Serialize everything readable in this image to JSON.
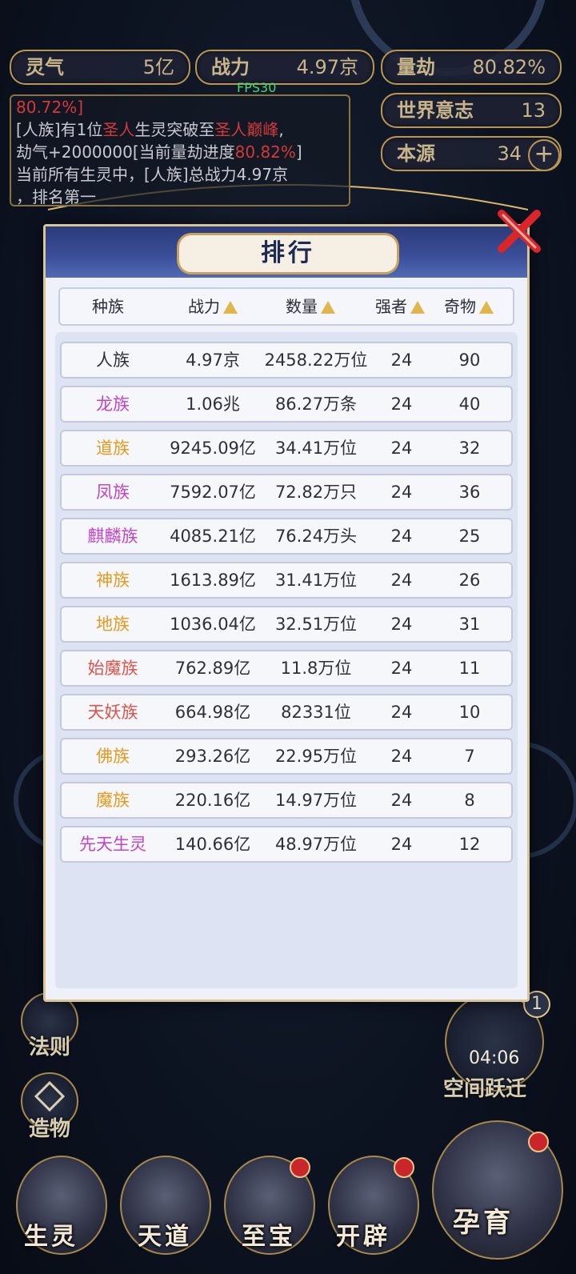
{
  "hud": {
    "lingqi_label": "灵气",
    "lingqi_value": "5亿",
    "power_label": "战力",
    "power_value": "4.97京",
    "jie_label": "量劫",
    "jie_value": "80.82%",
    "world_label": "世界意志",
    "world_value": "13",
    "source_label": "本源",
    "source_value": "34",
    "plus": "+",
    "fps": "FPS30"
  },
  "log": {
    "line1": "80.72%]",
    "line2_a": "[人族]有1位",
    "line2_b": "圣人",
    "line2_c": "生灵突破至",
    "line2_d": "圣人巅峰",
    "line2_e": ",",
    "line3_a": "劫气+2000000[当前量劫进度",
    "line3_b": "80.82%",
    "line3_c": "]",
    "line4": "当前所有生灵中，[人族]总战力4.97京",
    "line5": "，排名第一"
  },
  "side": {
    "fate_label": "法则",
    "create_label": "造物",
    "space_label": "空间跃迁",
    "timer": "04:06",
    "badge": "1"
  },
  "bottom": {
    "btn1": "生灵",
    "btn2": "天道",
    "btn3": "至宝",
    "btn4": "开辟",
    "btn5": "孕育"
  },
  "modal": {
    "title": "排行",
    "headers": {
      "race": "种族",
      "power": "战力",
      "count": "数量",
      "strong": "强者",
      "odd": "奇物"
    },
    "rows": [
      {
        "race": "人族",
        "color": "#2f2f3a",
        "power": "4.97京",
        "count": "2458.22万位",
        "strong": "24",
        "odd": "90"
      },
      {
        "race": "龙族",
        "color": "#c144c9",
        "power": "1.06兆",
        "count": "86.27万条",
        "strong": "24",
        "odd": "40"
      },
      {
        "race": "道族",
        "color": "#e59a1e",
        "power": "9245.09亿",
        "count": "34.41万位",
        "strong": "24",
        "odd": "32"
      },
      {
        "race": "凤族",
        "color": "#c144c9",
        "power": "7592.07亿",
        "count": "72.82万只",
        "strong": "24",
        "odd": "36"
      },
      {
        "race": "麒麟族",
        "color": "#c144c9",
        "power": "4085.21亿",
        "count": "76.24万头",
        "strong": "24",
        "odd": "25"
      },
      {
        "race": "神族",
        "color": "#e59a1e",
        "power": "1613.89亿",
        "count": "31.41万位",
        "strong": "24",
        "odd": "26"
      },
      {
        "race": "地族",
        "color": "#e59a1e",
        "power": "1036.04亿",
        "count": "32.51万位",
        "strong": "24",
        "odd": "31"
      },
      {
        "race": "始魔族",
        "color": "#e0524a",
        "power": "762.89亿",
        "count": "11.8万位",
        "strong": "24",
        "odd": "11"
      },
      {
        "race": "天妖族",
        "color": "#e0524a",
        "power": "664.98亿",
        "count": "82331位",
        "strong": "24",
        "odd": "10"
      },
      {
        "race": "佛族",
        "color": "#e59a1e",
        "power": "293.26亿",
        "count": "22.95万位",
        "strong": "24",
        "odd": "7"
      },
      {
        "race": "魔族",
        "color": "#e59a1e",
        "power": "220.16亿",
        "count": "14.97万位",
        "strong": "24",
        "odd": "8"
      },
      {
        "race": "先天生灵",
        "color": "#c144c9",
        "power": "140.66亿",
        "count": "48.97万位",
        "strong": "24",
        "odd": "12"
      }
    ]
  }
}
